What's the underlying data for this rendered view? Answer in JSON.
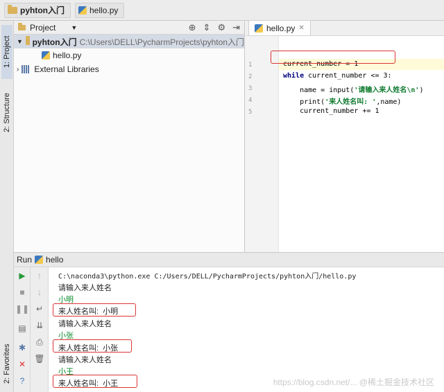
{
  "breadcrumb": {
    "project": "pyhton入门",
    "file": "hello.py"
  },
  "left_strip": {
    "project_tab": "1: Project",
    "structure_tab": "2: Structure",
    "favorites_tab": "2: Favorites"
  },
  "project_panel": {
    "title": "Project",
    "root_name": "pyhton入门",
    "root_path": "C:\\Users\\DELL\\PycharmProjects\\pyhton入门",
    "file": "hello.py",
    "libraries": "External Libraries"
  },
  "editor": {
    "tab_label": "hello.py",
    "line_numbers": [
      "1",
      "2",
      "3",
      "4",
      "5"
    ],
    "lines": {
      "l1": "current_number = 1",
      "l2_kw": "while",
      "l2_rest": " current_number <= 3:",
      "l3_pre": "    name = input(",
      "l3_str": "'请输入来人姓名\\n'",
      "l3_post": ")",
      "l4_pre": "    print(",
      "l4_str": "'来人姓名叫: '",
      "l4_post": ",name)",
      "l5": "    current_number += 1"
    }
  },
  "run": {
    "label": "Run",
    "config": "hello",
    "console": [
      "C:\\naconda3\\python.exe C:/Users/DELL/PycharmProjects/pyhton入门/hello.py",
      "请输入来人姓名",
      "小明",
      "来人姓名叫:  小明",
      "请输入来人姓名",
      "小张",
      "来人姓名叫:  小张",
      "请输入来人姓名",
      "小王",
      "来人姓名叫:  小王"
    ]
  },
  "watermark": "https://blog.csdn.net/... @稀土掘金技术社区",
  "colors": {
    "annotation_box": "#d33333",
    "user_input_text": "#0b8a2c",
    "string_literal": "#0d7a2e",
    "keyword": "#000080"
  }
}
